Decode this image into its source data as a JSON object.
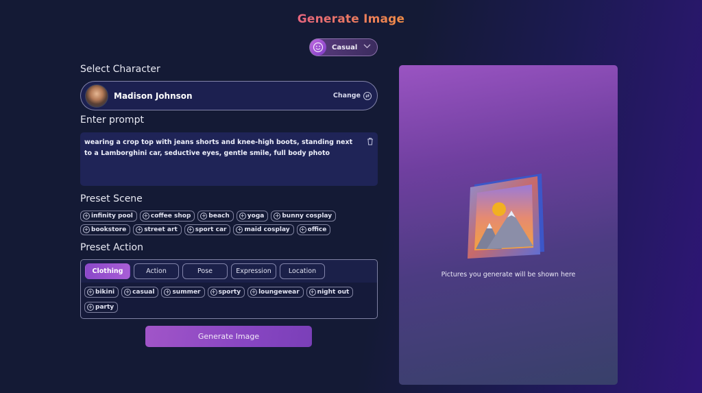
{
  "header": {
    "title": "Generate Image"
  },
  "mood": {
    "icon": "smiley-icon",
    "label": "Casual",
    "dropdown_icon": "chevron-down-icon"
  },
  "select_character": {
    "label": "Select Character",
    "name": "Madison Johnson",
    "change_label": "Change",
    "change_icon": "swap-icon"
  },
  "prompt": {
    "label": "Enter prompt",
    "value": "wearing a crop top with jeans shorts and knee-high boots, standing next to a Lamborghini car, seductive eyes, gentle smile, full body photo",
    "clear_icon": "trash-icon"
  },
  "preset_scene": {
    "label": "Preset Scene",
    "items": [
      "infinity pool",
      "coffee shop",
      "beach",
      "yoga",
      "bunny cosplay",
      "bookstore",
      "street art",
      "sport car",
      "maid cosplay",
      "office"
    ]
  },
  "preset_action": {
    "label": "Preset Action",
    "tabs": [
      "Clothing",
      "Action",
      "Pose",
      "Expression",
      "Location"
    ],
    "active_tab": "Clothing",
    "items": [
      "bikini",
      "casual",
      "summer",
      "sporty",
      "loungewear",
      "night out",
      "party"
    ]
  },
  "generate_button": {
    "label": "Generate Image"
  },
  "preview": {
    "placeholder_text": "Pictures you generate will be shown here",
    "icon": "image-frame-icon"
  },
  "colors": {
    "accent": "#9b52c9",
    "background": "#141a35",
    "panel": "#1f2457"
  }
}
